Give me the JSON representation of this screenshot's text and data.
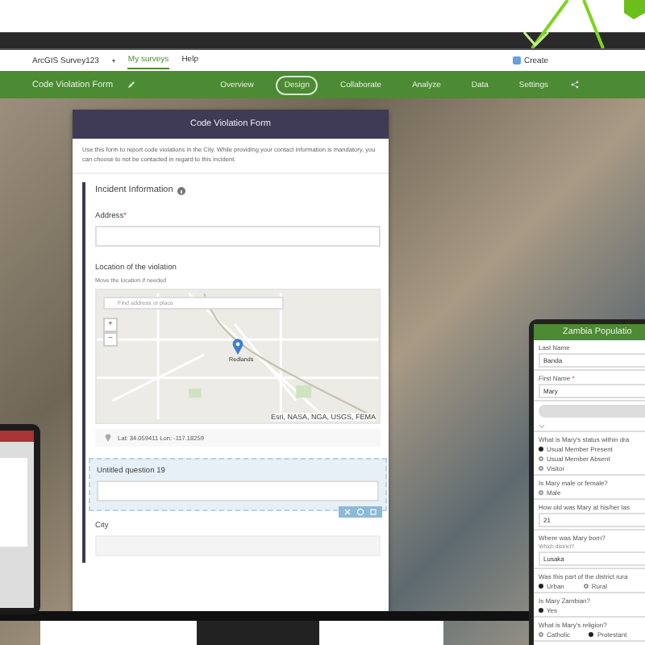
{
  "top_nav": {
    "app_name": "ArcGIS Survey123",
    "caret": "▾",
    "links": [
      {
        "label": "My surveys",
        "selected": true
      },
      {
        "label": "Help",
        "selected": false
      }
    ],
    "create_label": "Create"
  },
  "survey_bar": {
    "title": "Code Violation Form",
    "tabs": [
      {
        "label": "Overview",
        "selected": false
      },
      {
        "label": "Design",
        "selected": true
      },
      {
        "label": "Collaborate",
        "selected": false
      },
      {
        "label": "Analyze",
        "selected": false
      },
      {
        "label": "Data",
        "selected": false
      },
      {
        "label": "Settings",
        "selected": false
      }
    ]
  },
  "form": {
    "title": "Code Violation Form",
    "description": "Use this form to report code violations in the City. While providing your contact information is mandatory, you can choose to not be contacted in regard to this incident.",
    "section": "Incident Information",
    "questions": [
      {
        "kind": "text",
        "label": "Address",
        "required_mark": "*",
        "selected": false
      },
      {
        "kind": "map",
        "label": "Location of the violation",
        "hint": "Move the location if needed",
        "search_placeholder": "Find address or place",
        "zoom_in": "+",
        "zoom_out": "−",
        "place_label": "Redlands",
        "attribution": "Esri, NASA, NGA, USGS, FEMA",
        "coordinates": "Lat: 34.059411   Lon: -117.18259",
        "selected": false
      },
      {
        "kind": "text",
        "label": "Untitled question 19",
        "selected": true
      },
      {
        "kind": "text",
        "label": "City",
        "selected": false
      }
    ]
  },
  "tablet": {
    "title": "Zambia Populatio",
    "questions": [
      {
        "kind": "text",
        "label": "Last Name",
        "value": "Banda"
      },
      {
        "kind": "text",
        "label": "First Name",
        "value": "Mary",
        "required_mark": "*"
      },
      {
        "kind": "button"
      },
      {
        "kind": "radio",
        "label": "What is Mary's status within dra",
        "options": [
          {
            "label": "Usual Member Present",
            "selected": true
          },
          {
            "label": "Usual Member Absent",
            "selected": false
          },
          {
            "label": "Visitor",
            "selected": false
          }
        ]
      },
      {
        "kind": "radio",
        "label": "Is Mary male or female?",
        "options": [
          {
            "label": "Male",
            "selected": false
          }
        ]
      },
      {
        "kind": "text",
        "label": "How old was Mary at his/her las",
        "value": "21"
      },
      {
        "kind": "text",
        "label": "Where was Mary born?",
        "hint": "Which district?",
        "value": "Lusaka"
      },
      {
        "kind": "radio_row",
        "label": "Was this part of the district rura",
        "options": [
          {
            "label": "Urban",
            "selected": true
          },
          {
            "label": "Rural",
            "selected": false
          }
        ]
      },
      {
        "kind": "radio",
        "label": "Is Mary Zambian?",
        "options": [
          {
            "label": "Yes",
            "selected": true
          }
        ]
      },
      {
        "kind": "radio_row",
        "label": "What is Mary's religion?",
        "options": [
          {
            "label": "Catholic",
            "selected": false
          },
          {
            "label": "Protestant",
            "selected": true
          }
        ]
      }
    ]
  }
}
